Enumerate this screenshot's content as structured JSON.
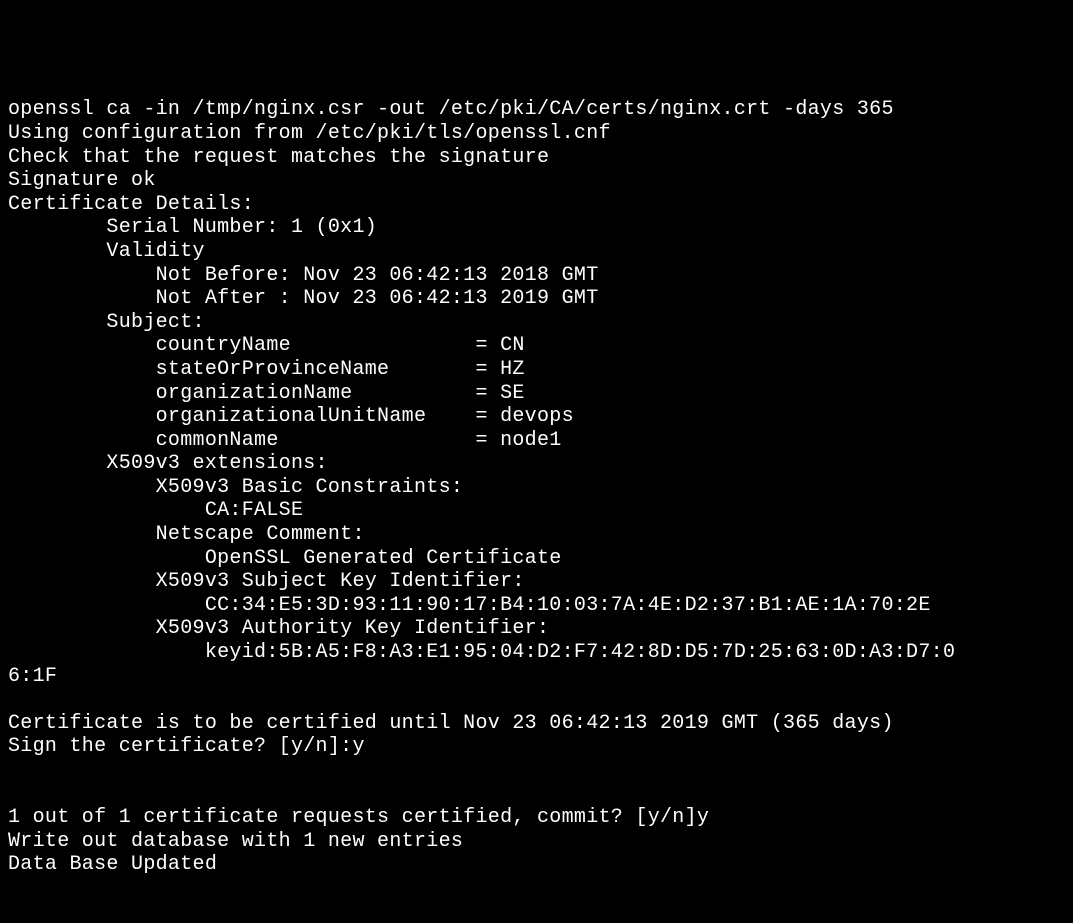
{
  "terminal": {
    "lines": [
      "openssl ca -in /tmp/nginx.csr -out /etc/pki/CA/certs/nginx.crt -days 365",
      "Using configuration from /etc/pki/tls/openssl.cnf",
      "Check that the request matches the signature",
      "Signature ok",
      "Certificate Details:",
      "        Serial Number: 1 (0x1)",
      "        Validity",
      "            Not Before: Nov 23 06:42:13 2018 GMT",
      "            Not After : Nov 23 06:42:13 2019 GMT",
      "        Subject:",
      "            countryName               = CN",
      "            stateOrProvinceName       = HZ",
      "            organizationName          = SE",
      "            organizationalUnitName    = devops",
      "            commonName                = node1",
      "        X509v3 extensions:",
      "            X509v3 Basic Constraints: ",
      "                CA:FALSE",
      "            Netscape Comment: ",
      "                OpenSSL Generated Certificate",
      "            X509v3 Subject Key Identifier: ",
      "                CC:34:E5:3D:93:11:90:17:B4:10:03:7A:4E:D2:37:B1:AE:1A:70:2E",
      "            X509v3 Authority Key Identifier: ",
      "                keyid:5B:A5:F8:A3:E1:95:04:D2:F7:42:8D:D5:7D:25:63:0D:A3:D7:0",
      "6:1F",
      "",
      "Certificate is to be certified until Nov 23 06:42:13 2019 GMT (365 days)",
      "Sign the certificate? [y/n]:y",
      "",
      "",
      "1 out of 1 certificate requests certified, commit? [y/n]y",
      "Write out database with 1 new entries",
      "Data Base Updated"
    ]
  }
}
